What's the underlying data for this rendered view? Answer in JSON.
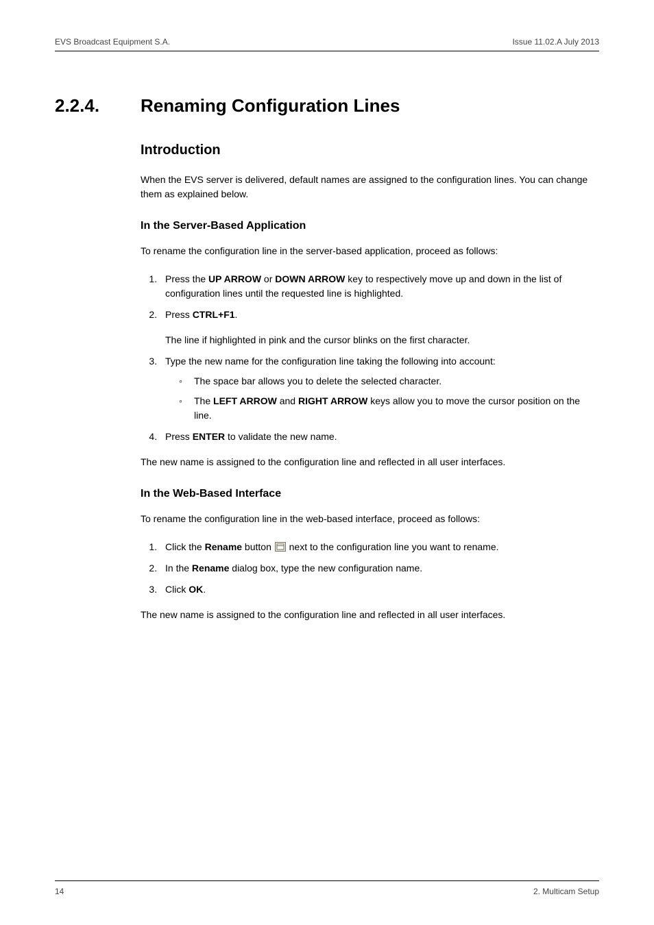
{
  "header": {
    "left": "EVS Broadcast Equipment S.A.",
    "right": "Issue 11.02.A  July 2013"
  },
  "section": {
    "number": "2.2.4.",
    "title": "Renaming Configuration Lines"
  },
  "intro": {
    "heading": "Introduction",
    "paragraph": "When the EVS server is delivered, default names are assigned to the configuration lines. You can change them as explained below."
  },
  "server": {
    "heading": "In the Server-Based Application",
    "lead": "To rename the configuration line in the server-based application, proceed as follows:",
    "step1_a": "Press the ",
    "step1_b": "UP ARROW",
    "step1_c": " or ",
    "step1_d": "DOWN ARROW",
    "step1_e": " key to respectively move up and down in the list of configuration lines until the requested line is highlighted.",
    "step2_a": "Press ",
    "step2_b": "CTRL+F1",
    "step2_c": ".",
    "step2_note": "The line if highlighted in pink and the cursor blinks on the first character.",
    "step3": "Type the new name for the configuration line taking the following into account:",
    "step3_sub1": "The space bar allows you to delete the selected character.",
    "step3_sub2_a": "The ",
    "step3_sub2_b": "LEFT ARROW",
    "step3_sub2_c": " and ",
    "step3_sub2_d": "RIGHT ARROW",
    "step3_sub2_e": " keys allow you to move the cursor position on the line.",
    "step4_a": "Press ",
    "step4_b": "ENTER",
    "step4_c": " to validate the new name.",
    "closing": "The new name is assigned to the configuration line and reflected in all user interfaces."
  },
  "web": {
    "heading": "In the Web-Based Interface",
    "lead": "To rename the configuration line in the web-based interface, proceed as follows:",
    "step1_a": "Click the ",
    "step1_b": "Rename",
    "step1_c": " button ",
    "step1_d": " next to the configuration line you want to rename.",
    "step2_a": "In the ",
    "step2_b": "Rename",
    "step2_c": " dialog box, type the new configuration name.",
    "step3_a": "Click ",
    "step3_b": "OK",
    "step3_c": ".",
    "closing": "The new name is assigned to the configuration line and reflected in all user interfaces."
  },
  "footer": {
    "left": "14",
    "right": "2. Multicam Setup"
  }
}
